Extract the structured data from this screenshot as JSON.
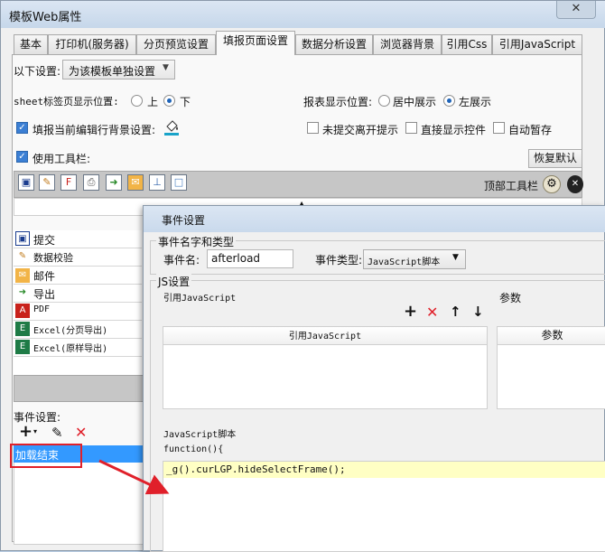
{
  "window": {
    "title": "模板Web属性",
    "close_label": "✕"
  },
  "tabs": [
    {
      "label": "基本"
    },
    {
      "label": "打印机(服务器)"
    },
    {
      "label": "分页预览设置"
    },
    {
      "label": "填报页面设置"
    },
    {
      "label": "数据分析设置"
    },
    {
      "label": "浏览器背景"
    },
    {
      "label": "引用Css"
    },
    {
      "label": "引用JavaScript"
    }
  ],
  "settings": {
    "scope_label": "以下设置:",
    "scope_value": "为该模板单独设置",
    "sheet_tab_label": "sheet标签页显示位置:",
    "sheet_tab_options": [
      "上",
      "下"
    ],
    "sheet_tab_selected": "下",
    "report_pos_label": "报表显示位置:",
    "report_pos_options": [
      "居中展示",
      "左展示"
    ],
    "report_pos_selected": "左展示",
    "edit_row_bg_label": "填报当前编辑行背景设置:",
    "no_leave_prompt": "未提交离开提示",
    "direct_show": "直接显示控件",
    "auto_save": "自动暂存",
    "use_toolbar": "使用工具栏:",
    "restore_default": "恢复默认",
    "top_toolbar": "顶部工具栏"
  },
  "toolbar_icons": [
    "save-icon",
    "validate-icon",
    "pdf-icon",
    "print-icon",
    "export-icon",
    "mail-icon",
    "hierarchy-icon",
    "window-icon"
  ],
  "buttons_list": [
    {
      "label": "提交",
      "icon": "save-icon"
    },
    {
      "label": "数据校验",
      "icon": "validate-icon"
    },
    {
      "label": "邮件",
      "icon": "mail-icon"
    },
    {
      "label": "导出",
      "icon": "export-icon"
    },
    {
      "label": "PDF",
      "icon": "pdf-icon"
    },
    {
      "label": "Excel(分页导出)",
      "icon": "excel-icon"
    },
    {
      "label": "Excel(原样导出)",
      "icon": "excel-icon"
    }
  ],
  "events": {
    "label": "事件设置:",
    "items": [
      {
        "label": "加载结束"
      }
    ]
  },
  "dialog": {
    "title": "事件设置",
    "group_name_type": "事件名字和类型",
    "event_name_label": "事件名:",
    "event_name_value": "afterload",
    "event_type_label": "事件类型:",
    "event_type_value": "JavaScript脚本",
    "js_group": "JS设置",
    "ref_js_label": "引用JavaScript",
    "params_label": "参数",
    "ref_js_header": "引用JavaScript",
    "params_header": "参数",
    "script_label": "JavaScript脚本",
    "code_line1": "function(){",
    "code_line2": "_g().curLGP.hideSelectFrame();"
  },
  "colors": {
    "accent": "#3a8ee6",
    "selection": "#3399ff",
    "annotation_red": "#e0202a"
  }
}
